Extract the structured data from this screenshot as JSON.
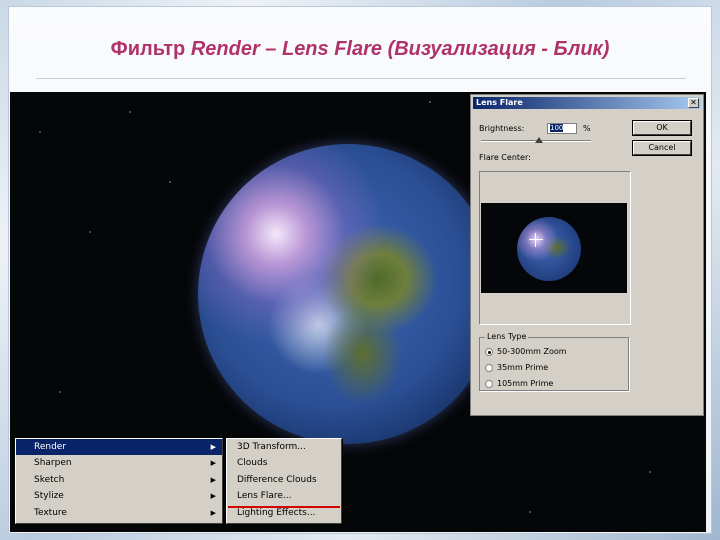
{
  "slide": {
    "title_prefix": "Фильтр ",
    "title_italic": "Render – Lens Flare (Визуализация - Блик)"
  },
  "dialog": {
    "title": "Lens Flare",
    "close_glyph": "✕",
    "brightness_label": "Brightness:",
    "brightness_value": "100",
    "brightness_unit": "%",
    "flare_center_label": "Flare Center:",
    "ok_label": "OK",
    "cancel_label": "Cancel",
    "lens_type_label": "Lens Type",
    "lens_types": [
      {
        "label": "50-300mm Zoom",
        "selected": true
      },
      {
        "label": "35mm Prime",
        "selected": false
      },
      {
        "label": "105mm Prime",
        "selected": false
      }
    ]
  },
  "filter_menu": {
    "items": [
      {
        "label": "Render",
        "active": true
      },
      {
        "label": "Sharpen",
        "active": false
      },
      {
        "label": "Sketch",
        "active": false
      },
      {
        "label": "Stylize",
        "active": false
      },
      {
        "label": "Texture",
        "active": false
      }
    ],
    "arrow_glyph": "▶"
  },
  "render_submenu": {
    "items": [
      {
        "label": "3D Transform..."
      },
      {
        "label": "Clouds"
      },
      {
        "label": "Difference Clouds"
      },
      {
        "label": "Lens Flare..."
      },
      {
        "label": "Lighting Effects..."
      }
    ],
    "highlight_color": "#d40000"
  }
}
